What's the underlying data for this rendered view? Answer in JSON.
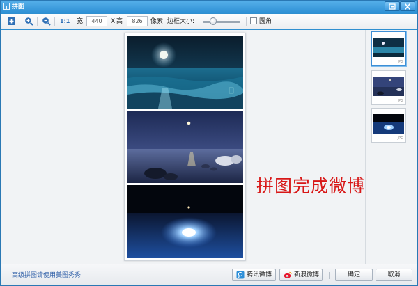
{
  "window": {
    "title": "拼图",
    "colors": {
      "titlebar": "#2d8fd4",
      "accent": "#3d8fd6",
      "caption": "#d81717",
      "link": "#2f5fa8"
    }
  },
  "toolbar": {
    "add_icon": "plus-square-icon",
    "zoom_in_icon": "zoom-in-icon",
    "zoom_out_icon": "zoom-out-icon",
    "actual_size_label": "1:1",
    "width_label": "宽",
    "width_value": "440",
    "times_label": "X",
    "height_label": "高",
    "height_value": "826",
    "pixel_label": "像素",
    "border_label": "边框大小:",
    "border_level": 0.25,
    "rounded_label": "圆角",
    "rounded_checked": false
  },
  "canvas": {
    "caption": "拼图完成微博分享",
    "photos": [
      "moon-over-ocean-photo",
      "moon-over-rocky-shore-photo",
      "moon-reflection-night-photo"
    ]
  },
  "thumbnails": [
    {
      "tag": "JPG",
      "selected": true
    },
    {
      "tag": "JPG",
      "selected": false
    },
    {
      "tag": "JPG",
      "selected": false
    }
  ],
  "bottombar": {
    "link_text": "高级拼图请使用美图秀秀",
    "tencent_weibo_label": "腾讯微博",
    "sina_weibo_label": "新浪微博",
    "ok_label": "确定",
    "cancel_label": "取消"
  }
}
